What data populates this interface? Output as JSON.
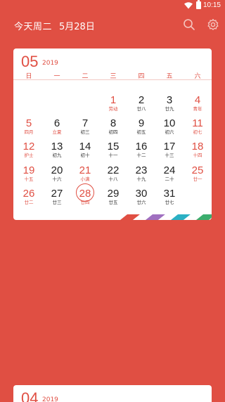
{
  "status": {
    "time": "10:15"
  },
  "header": {
    "today_label": "今天周二",
    "date_label": "5月28日"
  },
  "may": {
    "month": "05",
    "year": "2019",
    "weekdays": [
      "日",
      "一",
      "二",
      "三",
      "四",
      "五",
      "六"
    ],
    "days": [
      {
        "num": "1",
        "lunar": "劳动"
      },
      {
        "num": "2",
        "lunar": "廿八"
      },
      {
        "num": "3",
        "lunar": "廿九"
      },
      {
        "num": "4",
        "lunar": "青年"
      },
      {
        "num": "5",
        "lunar": "四月"
      },
      {
        "num": "6",
        "lunar": "立夏"
      },
      {
        "num": "7",
        "lunar": "初三"
      },
      {
        "num": "8",
        "lunar": "初四"
      },
      {
        "num": "9",
        "lunar": "初五"
      },
      {
        "num": "10",
        "lunar": "初六"
      },
      {
        "num": "11",
        "lunar": "初七"
      },
      {
        "num": "12",
        "lunar": "护士"
      },
      {
        "num": "13",
        "lunar": "初九"
      },
      {
        "num": "14",
        "lunar": "初十"
      },
      {
        "num": "15",
        "lunar": "十一"
      },
      {
        "num": "16",
        "lunar": "十二"
      },
      {
        "num": "17",
        "lunar": "十三"
      },
      {
        "num": "18",
        "lunar": "十四"
      },
      {
        "num": "19",
        "lunar": "十五"
      },
      {
        "num": "20",
        "lunar": "十六"
      },
      {
        "num": "21",
        "lunar": "小满"
      },
      {
        "num": "22",
        "lunar": "十八"
      },
      {
        "num": "23",
        "lunar": "十九"
      },
      {
        "num": "24",
        "lunar": "二十"
      },
      {
        "num": "25",
        "lunar": "廿一"
      },
      {
        "num": "26",
        "lunar": "廿二"
      },
      {
        "num": "27",
        "lunar": "廿三"
      },
      {
        "num": "28",
        "lunar": "廿四"
      },
      {
        "num": "29",
        "lunar": "廿五"
      },
      {
        "num": "30",
        "lunar": "廿六"
      },
      {
        "num": "31",
        "lunar": "廿七"
      }
    ]
  },
  "april": {
    "month": "04",
    "year": "2019"
  },
  "colors": {
    "accent": "#e04f43",
    "stripes": [
      "#e04f43",
      "#ffffff",
      "#a070c0",
      "#ffffff",
      "#2bb0c4",
      "#ffffff",
      "#3cae6e"
    ]
  }
}
